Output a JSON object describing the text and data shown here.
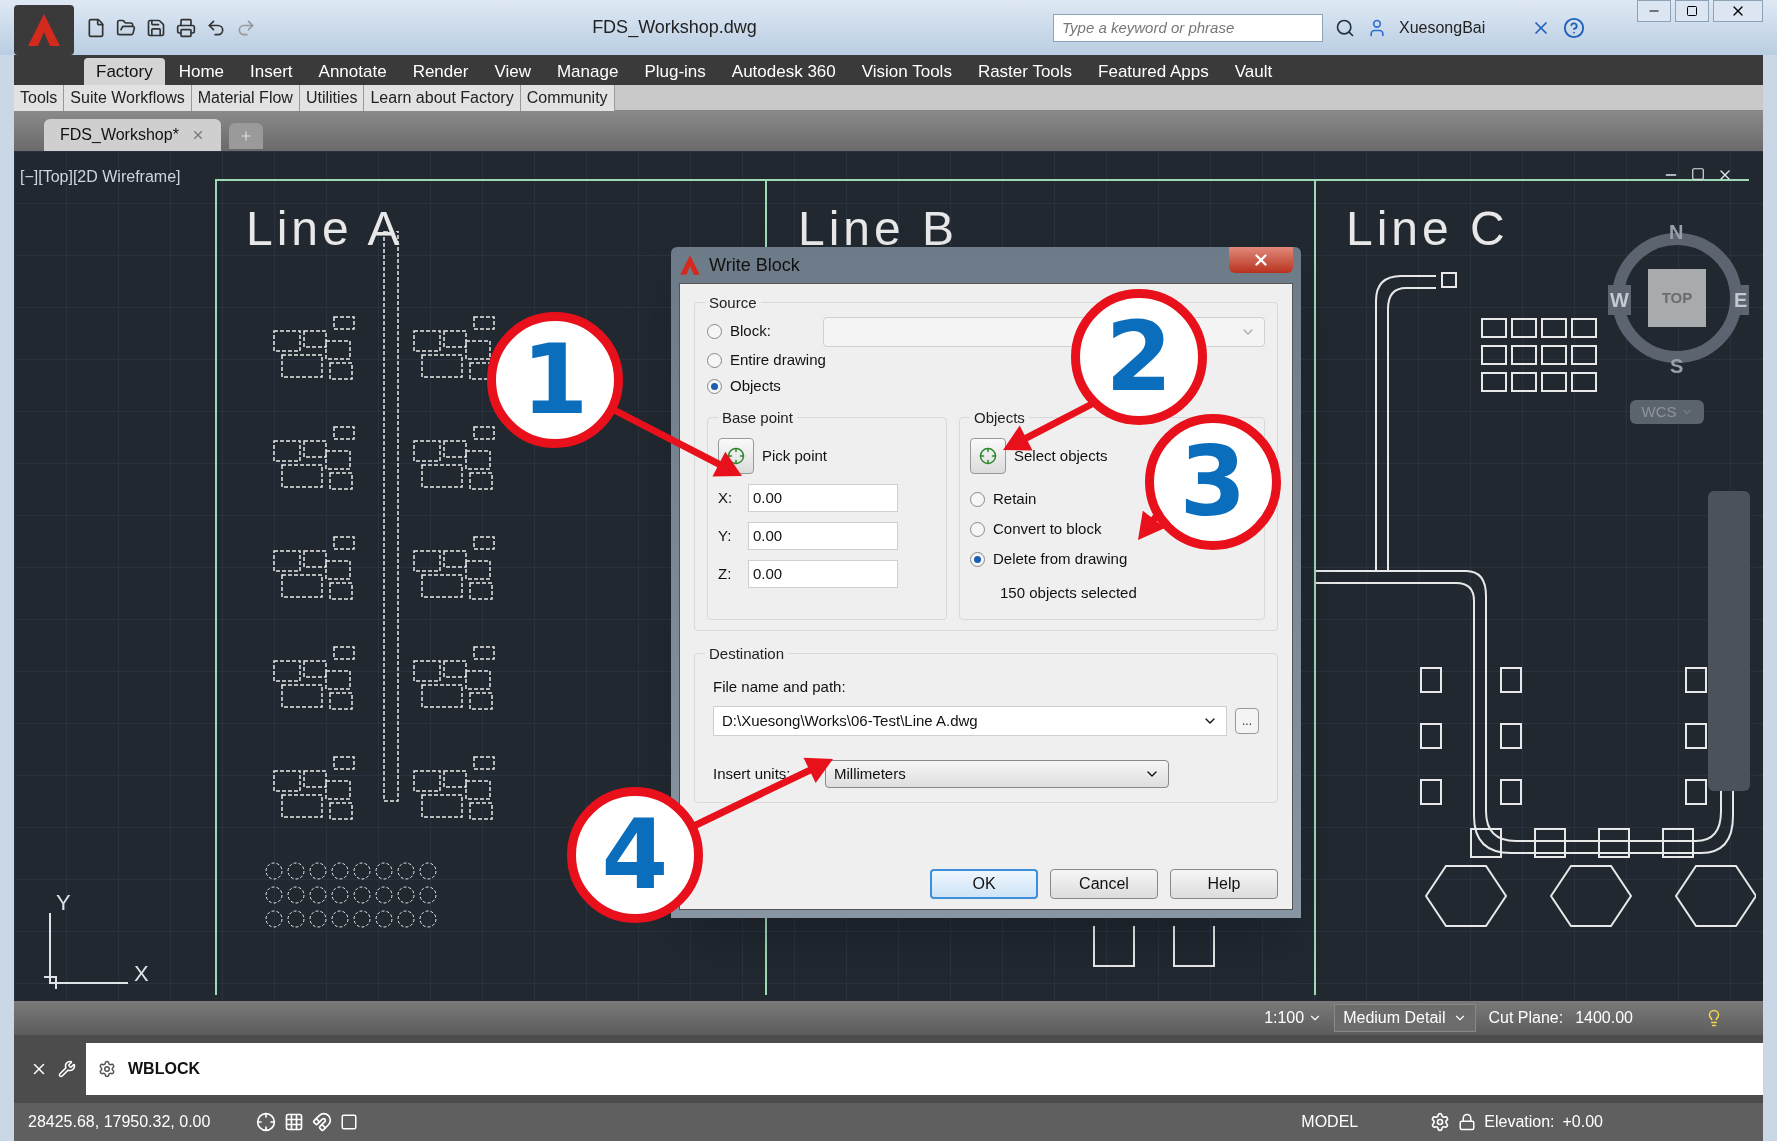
{
  "title_bar": {
    "title": "FDS_Workshop.dwg",
    "search": {
      "placeholder": "Type a keyword or phrase"
    },
    "user": "XuesongBai"
  },
  "ribbon_tabs": [
    {
      "label": "Factory",
      "selected": true
    },
    {
      "label": "Home",
      "selected": false
    },
    {
      "label": "Insert",
      "selected": false
    },
    {
      "label": "Annotate",
      "selected": false
    },
    {
      "label": "Render",
      "selected": false
    },
    {
      "label": "View",
      "selected": false
    },
    {
      "label": "Manage",
      "selected": false
    },
    {
      "label": "Plug-ins",
      "selected": false
    },
    {
      "label": "Autodesk 360",
      "selected": false
    },
    {
      "label": "Vision Tools",
      "selected": false
    },
    {
      "label": "Raster Tools",
      "selected": false
    },
    {
      "label": "Featured Apps",
      "selected": false
    },
    {
      "label": "Vault",
      "selected": false
    }
  ],
  "sub_tabs": [
    "Tools",
    "Suite Workflows",
    "Material Flow",
    "Utilities",
    "Learn about Factory",
    "Community"
  ],
  "document_tabs": [
    {
      "label": "FDS_Workshop*",
      "selected": true
    }
  ],
  "viewport": {
    "label": "[−][Top][2D Wireframe]",
    "zones": [
      "Line A",
      "Line B",
      "Line C"
    ],
    "viewcube": {
      "north": "N",
      "east": "E",
      "south": "S",
      "west": "W",
      "face": "TOP"
    },
    "ucs_menu": "WCS",
    "axes": {
      "x": "X",
      "y": "Y"
    }
  },
  "drawing_status": {
    "scale": "1:100",
    "detail": "Medium Detail",
    "cut_plane_label": "Cut Plane:",
    "cut_plane_value": "1400.00"
  },
  "command_line": {
    "command": "WBLOCK"
  },
  "status_bar": {
    "coordinates": "28425.68, 17950.32, 0.00",
    "space": "MODEL",
    "elevation_label": "Elevation:",
    "elevation_value": "+0.00"
  },
  "dialog": {
    "title": "Write Block",
    "source": {
      "label": "Source",
      "options": [
        {
          "label": "Block:",
          "selected": false
        },
        {
          "label": "Entire drawing",
          "selected": false
        },
        {
          "label": "Objects",
          "selected": true
        }
      ],
      "block_dropdown": {
        "disabled": true
      }
    },
    "base_point": {
      "label": "Base point",
      "button": "Pick point",
      "fields": [
        {
          "label": "X:",
          "value": "0.00"
        },
        {
          "label": "Y:",
          "value": "0.00"
        },
        {
          "label": "Z:",
          "value": "0.00"
        }
      ]
    },
    "objects": {
      "label": "Objects",
      "button": "Select objects",
      "options": [
        {
          "label": "Retain",
          "selected": false
        },
        {
          "label": "Convert to block",
          "selected": false
        },
        {
          "label": "Delete from drawing",
          "selected": true
        }
      ],
      "summary": "150 objects selected"
    },
    "destination": {
      "label": "Destination",
      "path_label": "File name and path:",
      "path": "D:\\Xuesong\\Works\\06-Test\\Line A.dwg",
      "browse": "...",
      "units_label": "Insert units:",
      "units": "Millimeters"
    },
    "buttons": [
      {
        "label": "OK",
        "default": true
      },
      {
        "label": "Cancel",
        "default": false
      },
      {
        "label": "Help",
        "default": false
      }
    ]
  },
  "callouts": [
    "1",
    "2",
    "3",
    "4"
  ]
}
